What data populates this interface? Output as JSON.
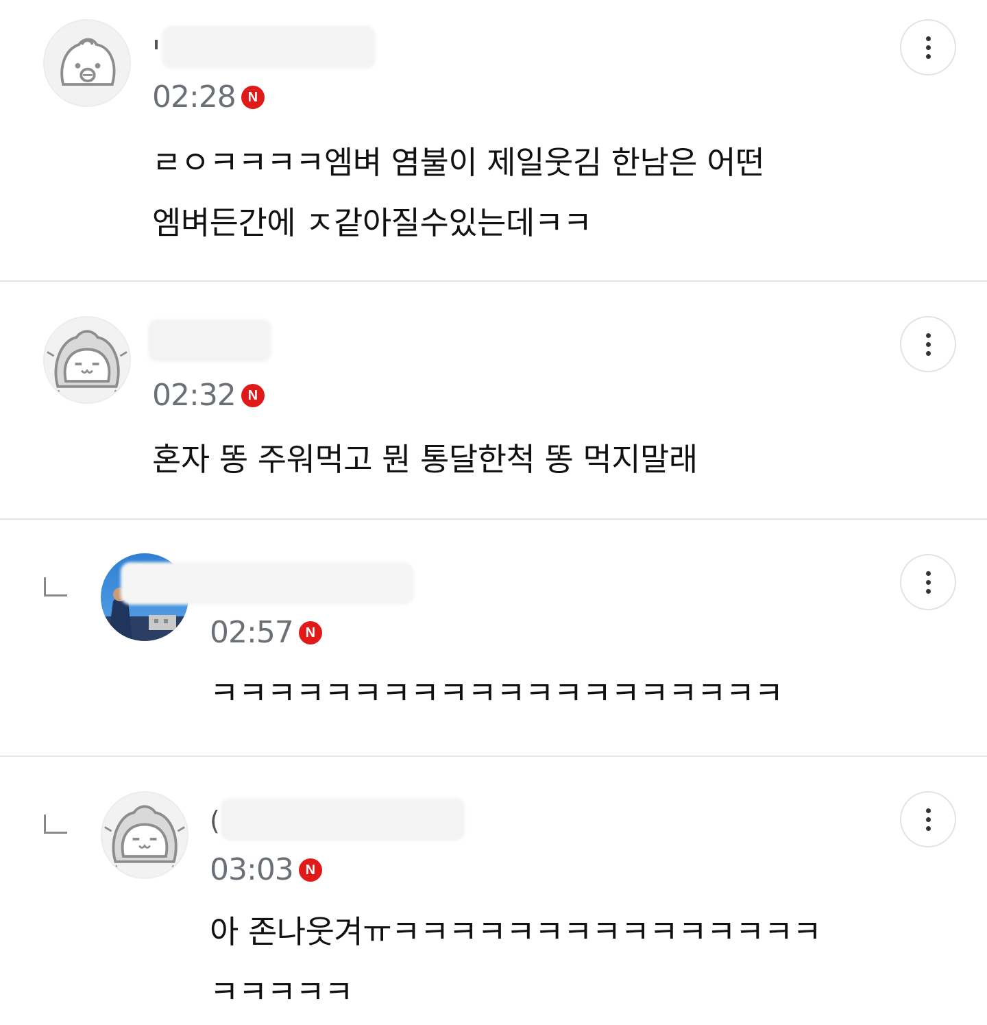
{
  "comments": [
    {
      "author_visible": "",
      "time": "02:28",
      "new_badge": "N",
      "avatar_icon": "kakao-character-icon",
      "is_reply": false,
      "lines": [
        "ㄹㅇㅋㅋㅋㅋ엠벼 염불이 제일웃김 한남은 어떤",
        "엠벼든간에 ㅈ같아질수있는데ㅋㅋ"
      ]
    },
    {
      "author_visible": "",
      "time": "02:32",
      "new_badge": "N",
      "avatar_icon": "hooded-character-icon",
      "is_reply": false,
      "lines": [
        "혼자 똥 주워먹고 뭔 통달한척 똥 먹지말래"
      ]
    },
    {
      "author_visible": "",
      "time": "02:57",
      "new_badge": "N",
      "avatar_icon": "photo-avatar",
      "is_reply": true,
      "lines": [
        "ㅋㅋㅋㅋㅋㅋㅋㅋㅋㅋㅋㅋㅋㅋㅋㅋㅋㅋㅋㅋ"
      ]
    },
    {
      "author_visible": "(",
      "time": "03:03",
      "new_badge": "N",
      "avatar_icon": "hooded-character-icon",
      "is_reply": true,
      "lines": [
        "아 존나웃겨ㅠㅋㅋㅋㅋㅋㅋㅋㅋㅋㅋㅋㅋㅋㅋㅋ",
        "ㅋㅋㅋㅋㅋ"
      ]
    }
  ],
  "icons": {
    "more": "more-vertical-icon",
    "reply": "reply-arrow-icon",
    "new": "new-badge-icon"
  },
  "colors": {
    "badge": "#e01919",
    "time": "#6b6f76",
    "divider": "#e5e5e5",
    "text": "#111111"
  }
}
